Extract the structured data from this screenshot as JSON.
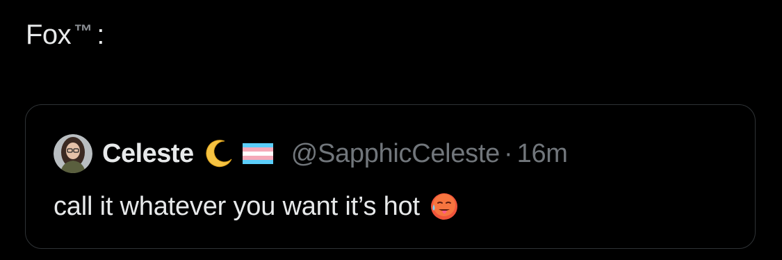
{
  "post": {
    "author": "Fox",
    "author_suffix": "™",
    "separator": ":"
  },
  "quote": {
    "avatar": "avatar",
    "display_name": "Celeste",
    "name_emojis": [
      "crescent-moon-icon",
      "transgender-flag-icon"
    ],
    "handle": "@SapphicCeleste",
    "dot": "·",
    "time": "16m",
    "text": "call it whatever you want it’s hot",
    "text_emoji": "hot-face-icon"
  },
  "colors": {
    "background": "#000000",
    "primary_text": "#e7e9ea",
    "secondary_text": "#71767b",
    "card_border": "#2f3336"
  }
}
